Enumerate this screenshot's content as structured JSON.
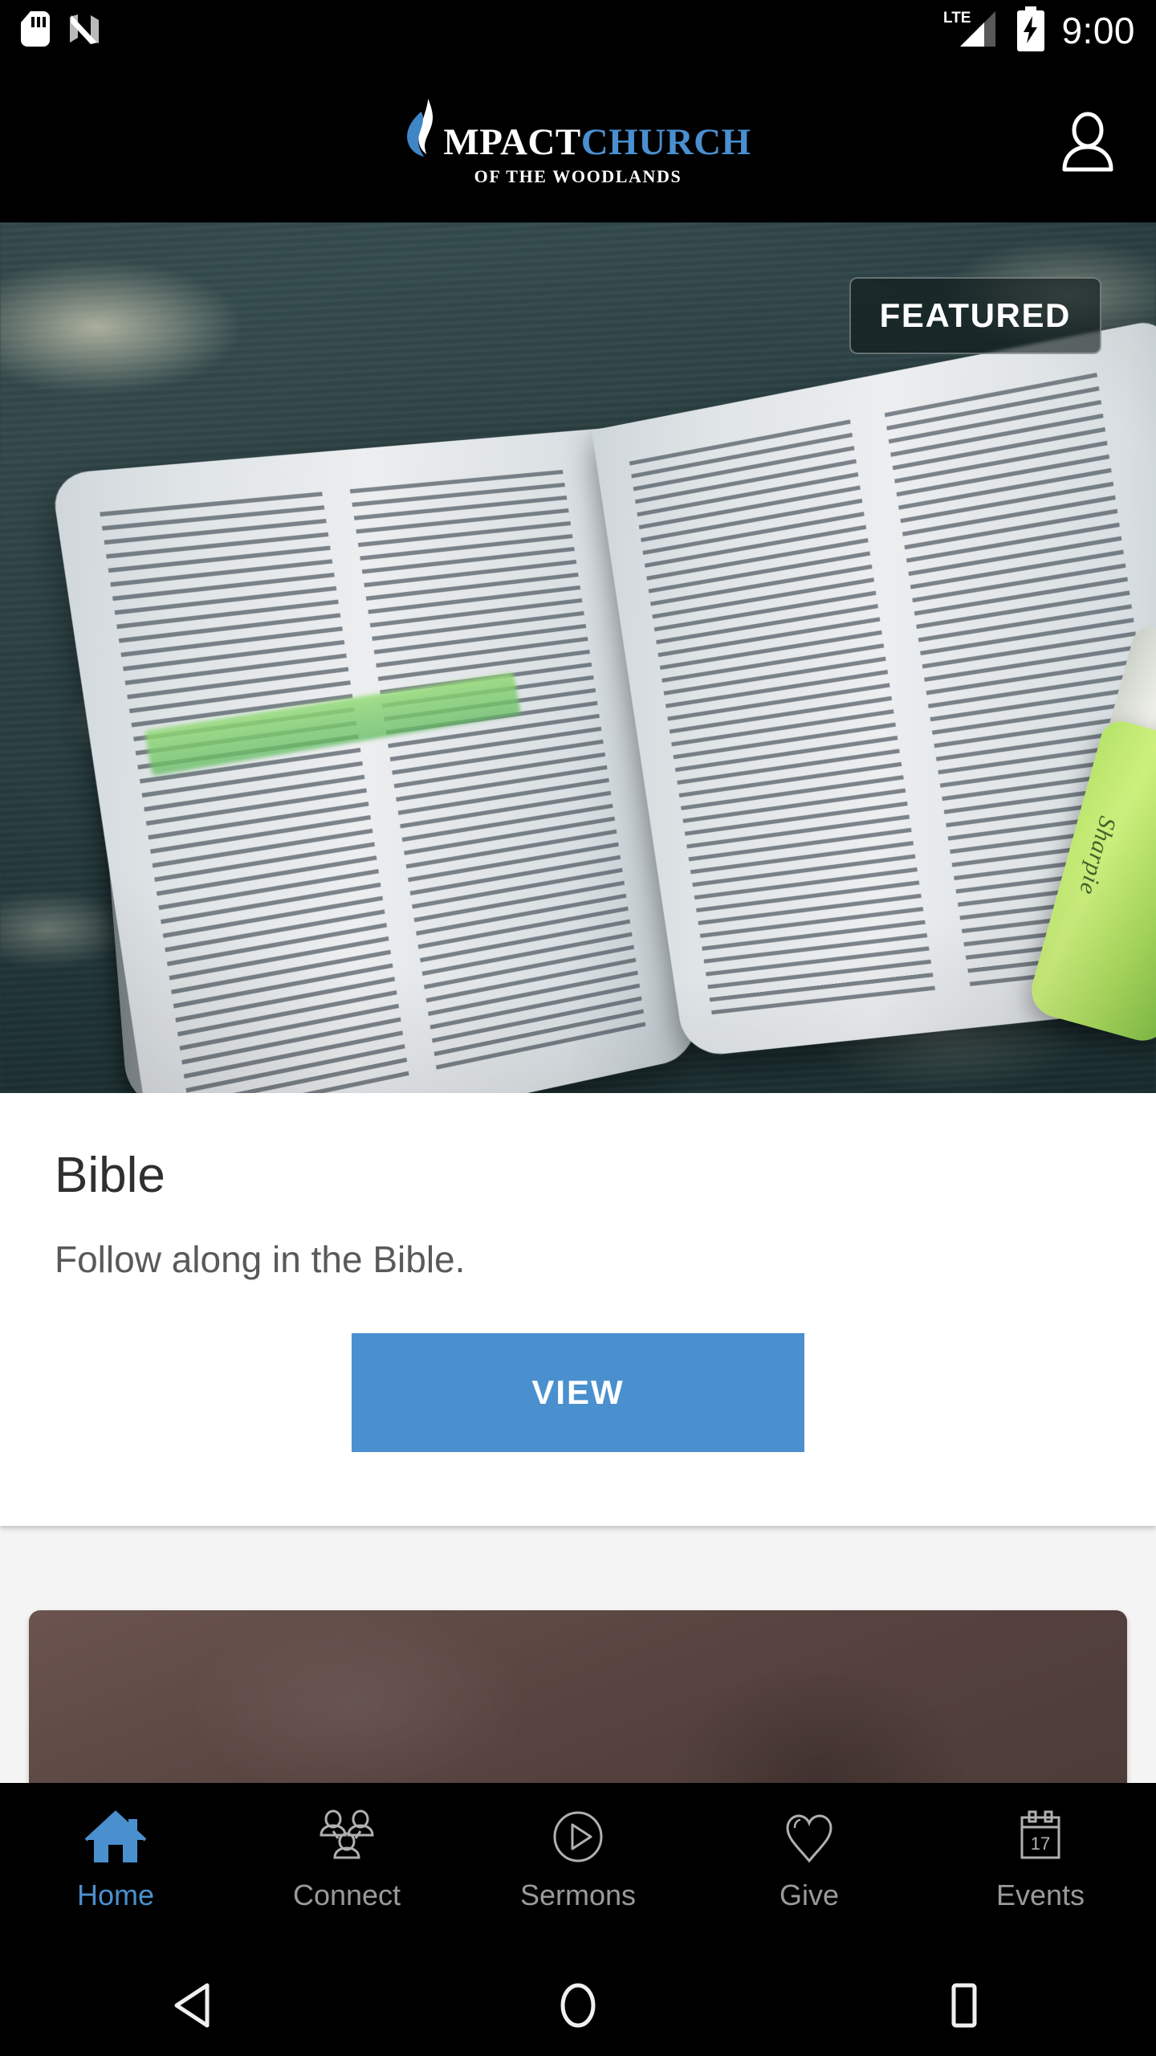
{
  "status_bar": {
    "icons": [
      "sd-card-icon",
      "nfc-icon"
    ],
    "network_label": "LTE",
    "signal_icon": "signal-bars-icon",
    "battery_icon": "battery-charging-icon",
    "time": "9:00"
  },
  "app_header": {
    "logo": {
      "flame_icon": "flame-logo-icon",
      "name_part1": "MPACT",
      "name_part2": "CHURCH",
      "subtitle": "OF THE WOODLANDS",
      "accent_color": "#4a8fd0",
      "text_color": "#ffffff"
    },
    "account_icon": "account-person-icon"
  },
  "featured_card": {
    "badge_label": "FEATURED",
    "hero_image_alt": "open-bible-with-green-highlighter",
    "title": "Bible",
    "description": "Follow along in the Bible.",
    "button_label": "VIEW",
    "button_color": "#4a90ce"
  },
  "next_card": {
    "hero_image_alt": "dark-brown-photo-card"
  },
  "tab_bar": {
    "active_color": "#4a90ce",
    "inactive_color": "#9a9a9a",
    "items": [
      {
        "label": "Home",
        "icon": "home-icon",
        "active": true
      },
      {
        "label": "Connect",
        "icon": "people-icon",
        "active": false
      },
      {
        "label": "Sermons",
        "icon": "play-circle-icon",
        "active": false
      },
      {
        "label": "Give",
        "icon": "heart-icon",
        "active": false
      },
      {
        "label": "Events",
        "icon": "calendar-icon",
        "active": false,
        "badge": "17"
      }
    ]
  },
  "android_nav": {
    "items": [
      {
        "name": "back-button",
        "icon": "triangle-left-icon"
      },
      {
        "name": "home-button",
        "icon": "circle-icon"
      },
      {
        "name": "recents-button",
        "icon": "square-icon"
      }
    ]
  }
}
